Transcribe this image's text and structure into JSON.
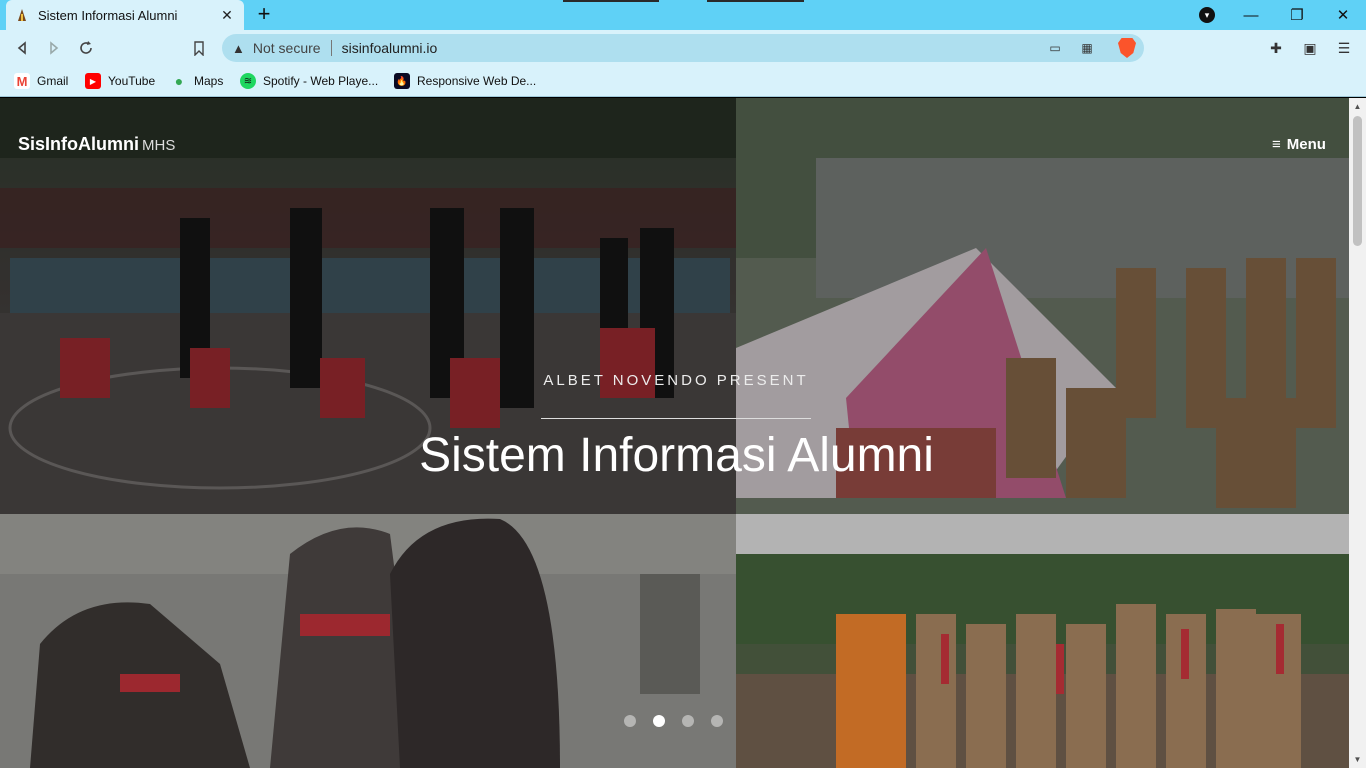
{
  "browser": {
    "tab_title": "Sistem Informasi Alumni",
    "tab_close": "✕",
    "new_tab": "+",
    "url_status": "Not secure",
    "url": "sisinfoalumni.io",
    "window_controls": {
      "minimize": "—",
      "restore": "❐",
      "close": "✕"
    }
  },
  "bookmarks": [
    {
      "label": "Gmail",
      "icon": "gmail-icon",
      "color": "#ea4335",
      "glyph": "M"
    },
    {
      "label": "YouTube",
      "icon": "youtube-icon",
      "color": "#ff0000",
      "glyph": "▶"
    },
    {
      "label": "Maps",
      "icon": "maps-icon",
      "color": "#34a853",
      "glyph": "●"
    },
    {
      "label": "Spotify - Web Playe...",
      "icon": "spotify-icon",
      "color": "#1ed760",
      "glyph": "≋"
    },
    {
      "label": "Responsive Web De...",
      "icon": "freecodecamp-icon",
      "color": "#0a0a23",
      "glyph": "🔥"
    }
  ],
  "site": {
    "brand": "SisInfoAlumni",
    "brand_sub": "MHS",
    "menu_label": "Menu",
    "menu_icon": "≡"
  },
  "hero": {
    "kicker": "ALBET NOVENDO PRESENT",
    "title": "Sistem Informasi Alumni"
  },
  "carousel": {
    "slide_count": 4,
    "active_index": 1
  },
  "colors": {
    "tabbar": "#5fd1f6",
    "toolbar": "#d8f2fb",
    "omnibox": "#aedfef"
  }
}
